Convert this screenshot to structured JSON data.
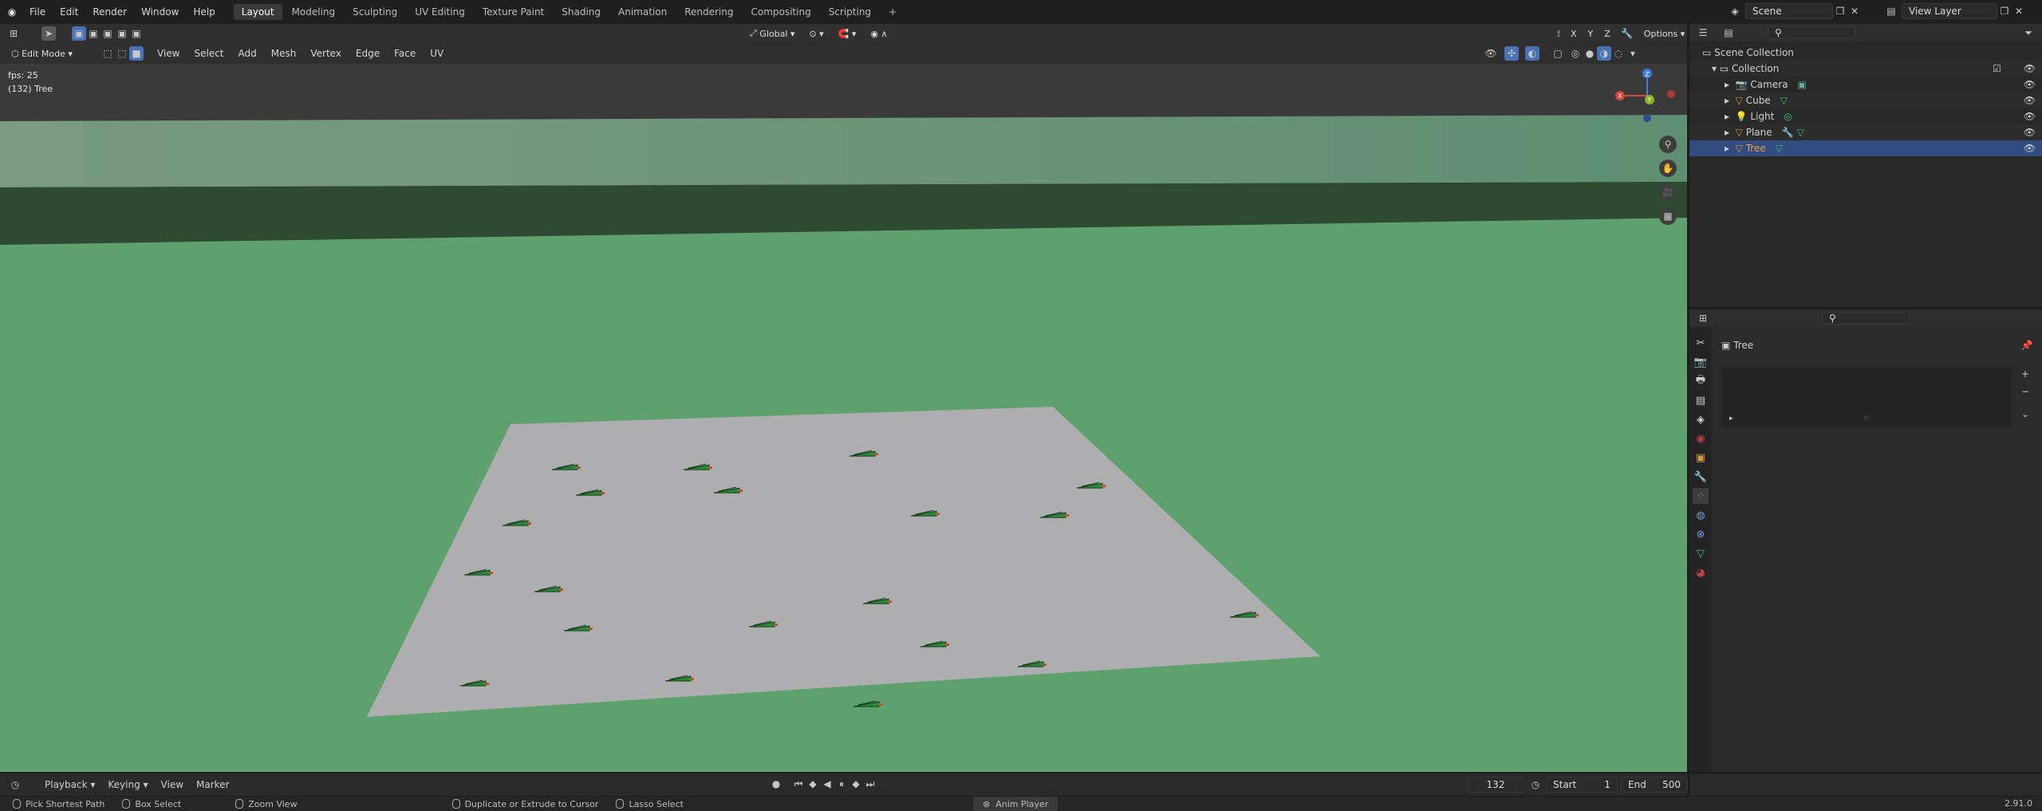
{
  "topbar": {
    "menus": [
      "File",
      "Edit",
      "Render",
      "Window",
      "Help"
    ],
    "workspaces": [
      "Layout",
      "Modeling",
      "Sculpting",
      "UV Editing",
      "Texture Paint",
      "Shading",
      "Animation",
      "Rendering",
      "Compositing",
      "Scripting"
    ],
    "active_workspace": "Layout",
    "add_tab": "+",
    "scene": "Scene",
    "view_layer": "View Layer"
  },
  "tool_header": {
    "transform_orientation": "Global",
    "axes": [
      "X",
      "Y",
      "Z"
    ],
    "options_label": "Options"
  },
  "viewport_header": {
    "mode": "Edit Mode",
    "menus": [
      "View",
      "Select",
      "Add",
      "Mesh",
      "Vertex",
      "Edge",
      "Face",
      "UV"
    ]
  },
  "viewport": {
    "fps": "fps: 25",
    "active_object": "(132) Tree",
    "gizmo": {
      "x": "X",
      "y": "Y",
      "z": "Z"
    },
    "colors": {
      "ground": "#5fa06f",
      "plane": "#aeaeb0",
      "sky": "#6c9a7a",
      "horizon": "#2e4a31",
      "tree": "#2c8a3a",
      "trunk": "#b3552e"
    }
  },
  "outliner": {
    "root": "Scene Collection",
    "collection": "Collection",
    "items": [
      {
        "name": "Camera",
        "icon": "camera-icon",
        "selected": false
      },
      {
        "name": "Cube",
        "icon": "mesh-icon",
        "selected": false
      },
      {
        "name": "Light",
        "icon": "light-icon",
        "selected": false
      },
      {
        "name": "Plane",
        "icon": "mesh-icon",
        "selected": false
      },
      {
        "name": "Tree",
        "icon": "mesh-icon",
        "selected": true
      }
    ]
  },
  "properties": {
    "object_name": "Tree"
  },
  "timeline": {
    "menus": [
      "Playback",
      "Keying",
      "View",
      "Marker"
    ],
    "current_frame": "132",
    "start_label": "Start",
    "start": "1",
    "end_label": "End",
    "end": "500"
  },
  "statusbar": {
    "items": [
      "Pick Shortest Path",
      "Box Select",
      "Zoom View",
      "Duplicate or Extrude to Cursor",
      "Lasso Select"
    ],
    "center": "Anim Player",
    "version": "2.91.0"
  }
}
